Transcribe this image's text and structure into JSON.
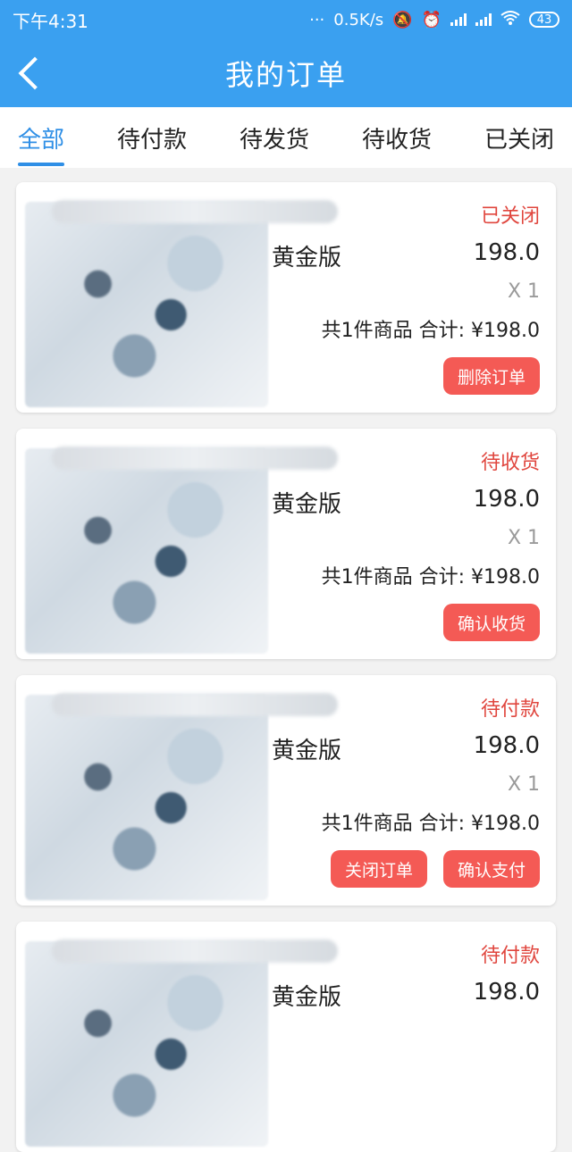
{
  "status_bar": {
    "time": "下午4:31",
    "dots": "···",
    "network_speed": "0.5K/s",
    "battery": "43"
  },
  "header": {
    "back_icon": "chevron-left-icon",
    "title": "我的订单"
  },
  "tabs": [
    {
      "label": "全部",
      "active": true
    },
    {
      "label": "待付款",
      "active": false
    },
    {
      "label": "待发货",
      "active": false
    },
    {
      "label": "待收货",
      "active": false
    },
    {
      "label": "已关闭",
      "active": false
    }
  ],
  "orders": [
    {
      "status": "已关闭",
      "product": "黄金版",
      "price": "198.0",
      "quantity": "X 1",
      "summary": "共1件商品 合计: ¥198.0",
      "actions": [
        "删除订单"
      ]
    },
    {
      "status": "待收货",
      "product": "黄金版",
      "price": "198.0",
      "quantity": "X 1",
      "summary": "共1件商品 合计: ¥198.0",
      "actions": [
        "确认收货"
      ]
    },
    {
      "status": "待付款",
      "product": "黄金版",
      "price": "198.0",
      "quantity": "X 1",
      "summary": "共1件商品 合计: ¥198.0",
      "actions": [
        "关闭订单",
        "确认支付"
      ]
    },
    {
      "status": "待付款",
      "product": "黄金版",
      "price": "198.0",
      "quantity": "",
      "summary": "",
      "actions": []
    }
  ],
  "colors": {
    "primary": "#3aa0f0",
    "tab_active": "#2f8fe6",
    "status_text": "#e0463e",
    "button": "#f45a55"
  }
}
